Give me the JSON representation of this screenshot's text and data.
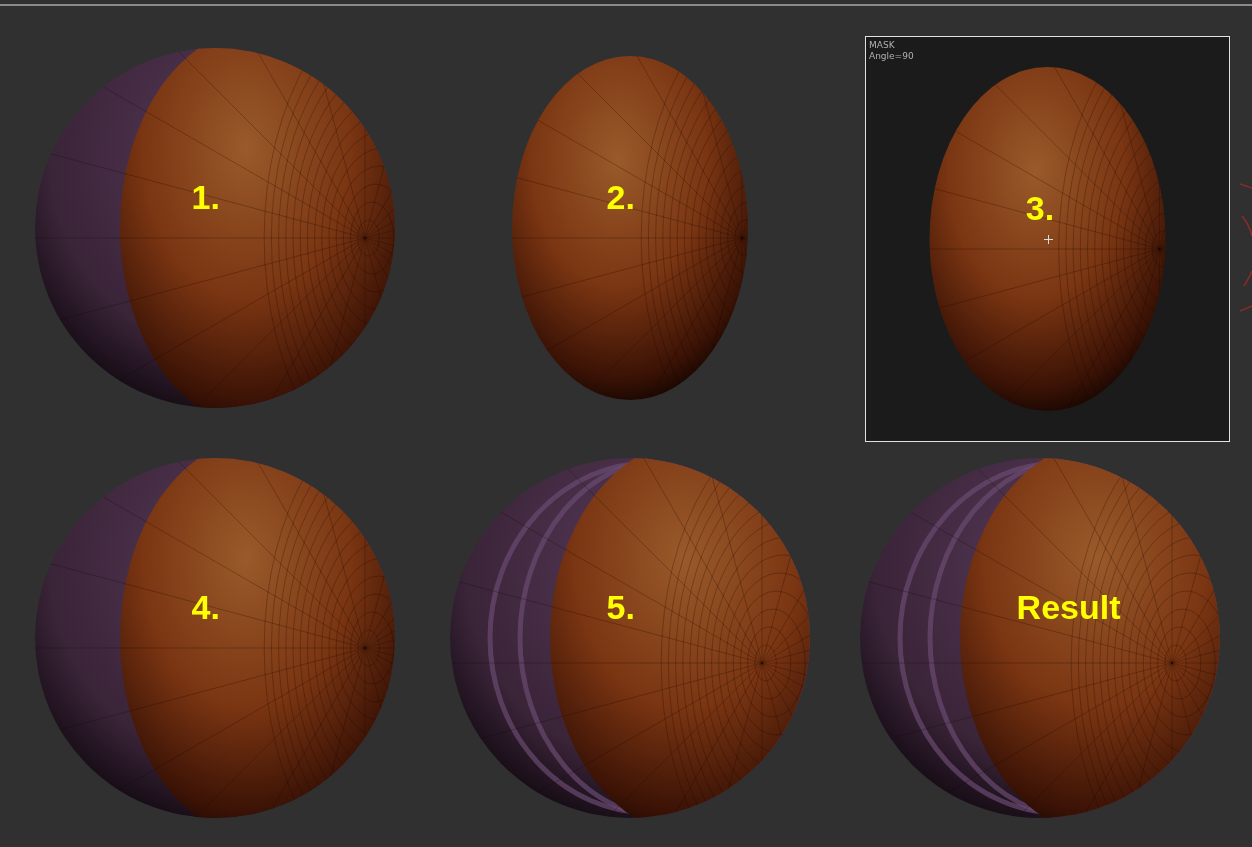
{
  "panels": [
    {
      "label": "1.",
      "kind": "band",
      "framed": false
    },
    {
      "label": "2.",
      "kind": "cap",
      "framed": false
    },
    {
      "label": "3.",
      "kind": "cap",
      "framed": true,
      "caption": [
        "MASK",
        "Angle=90"
      ]
    },
    {
      "label": "4.",
      "kind": "band",
      "framed": false
    },
    {
      "label": "5.",
      "kind": "ridged",
      "framed": false
    },
    {
      "label": "Result",
      "kind": "ridged",
      "framed": false
    }
  ]
}
